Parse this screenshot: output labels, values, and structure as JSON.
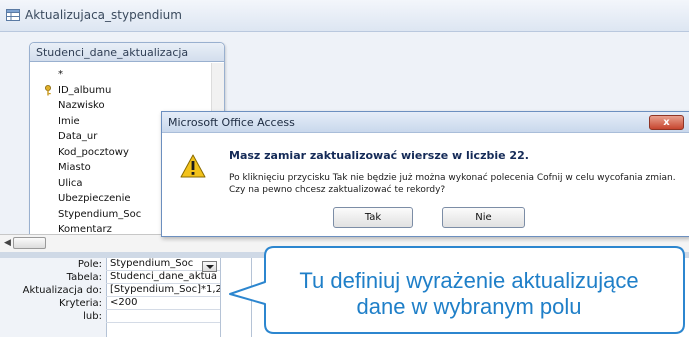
{
  "window": {
    "title": "Aktualizujaca_stypendium"
  },
  "table": {
    "name": "Studenci_dane_aktualizacja",
    "fields": [
      "*",
      "ID_albumu",
      "Nazwisko",
      "Imie",
      "Data_ur",
      "Kod_pocztowy",
      "Miasto",
      "Ulica",
      "Ubezpieczenie",
      "Stypendium_Soc",
      "Komentarz"
    ],
    "key_field": "ID_albumu"
  },
  "design_grid": {
    "row_labels": [
      "Pole:",
      "Tabela:",
      "Aktualizacja do:",
      "Kryteria:",
      "lub:"
    ],
    "column1": [
      "Stypendium_Soc",
      "Studenci_dane_aktua",
      "[Stypendium_Soc]*1,2",
      "<200",
      ""
    ]
  },
  "dialog": {
    "title": "Microsoft Office Access",
    "close_label": "x",
    "heading": "Masz zamiar zaktualizować wiersze w liczbie 22.",
    "body_line1": "Po kliknięciu przycisku Tak nie będzie już można wykonać polecenia Cofnij w celu wycofania zmian.",
    "body_line2": "Czy na pewno chcesz zaktualizować te rekordy?",
    "yes_label": "Tak",
    "no_label": "Nie",
    "icon": "warning-icon"
  },
  "callout": {
    "line1": "Tu definiuj wyrażenie aktualizujące",
    "line2": "dane w wybranym polu",
    "color": "#1f7fc8"
  },
  "colors": {
    "accent": "#1f7fc8",
    "dialog_border": "#6c8fbf",
    "close_button": "#c6452f"
  }
}
